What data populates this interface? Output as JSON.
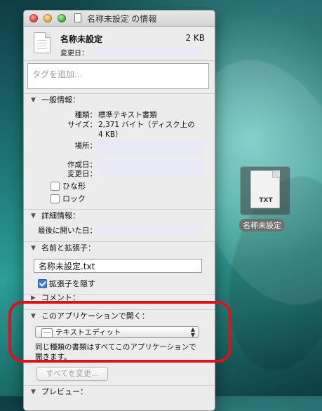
{
  "window": {
    "title": "名称未設定 の情報",
    "file_name": "名称未設定",
    "file_size": "2 KB",
    "modified_label": "変更日："
  },
  "tags": {
    "placeholder": "タグを追加..."
  },
  "general": {
    "heading": "一般情報：",
    "kind_label": "種類：",
    "kind_value": "標準テキスト書類",
    "size_label": "サイズ：",
    "size_value_line1": "2,371 バイト（ディスク上の",
    "size_value_line2": "4 KB）",
    "where_label": "場所：",
    "created_label": "作成日：",
    "modified_label": "変更日：",
    "stationery_label": "ひな形",
    "locked_label": "ロック"
  },
  "more_info": {
    "heading": "詳細情報：",
    "last_opened_label": "最後に開いた日："
  },
  "name_ext": {
    "heading": "名前と拡張子：",
    "filename": "名称未設定.txt",
    "hide_ext_label": "拡張子を隠す",
    "hide_ext_checked": true
  },
  "comments": {
    "heading": "コメント："
  },
  "open_with": {
    "heading": "このアプリケーションで開く：",
    "selected_app": "テキストエディット",
    "description": "同じ種類の書類はすべてこのアプリケーションで開きます。",
    "change_all_button": "すべてを変更..."
  },
  "preview": {
    "heading": "プレビュー："
  },
  "desktop_file": {
    "label": "名称未設定",
    "badge": "TXT"
  },
  "colors": {
    "annotation": "#e0101a",
    "accent": "#3f7cda"
  }
}
